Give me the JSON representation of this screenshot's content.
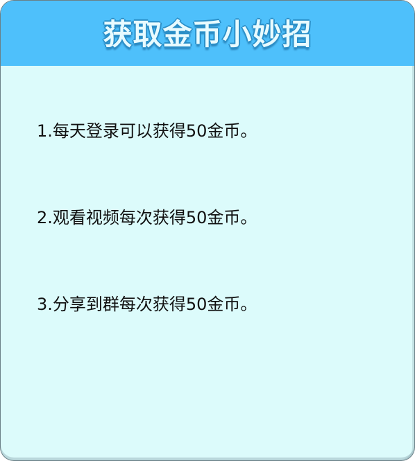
{
  "header": {
    "title": "获取金币小妙招"
  },
  "tips": [
    "1.每天登录可以获得50金币。",
    "2.观看视频每次获得50金币。",
    "3.分享到群每次获得50金币。"
  ],
  "colors": {
    "header_bg": "#4ec0fb",
    "panel_bg": "#dcfbfb",
    "title_text": "#e8fbff",
    "body_text": "#111111"
  }
}
